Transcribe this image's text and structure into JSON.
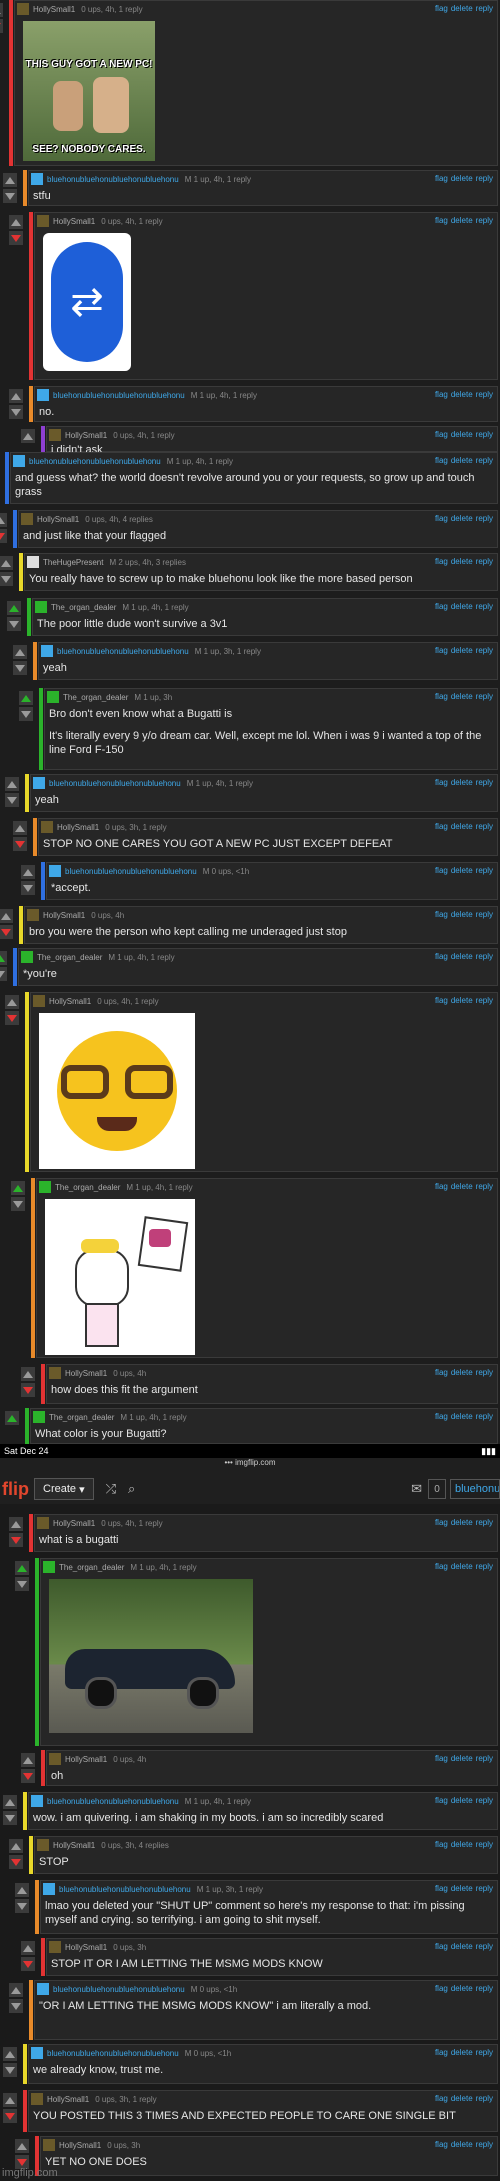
{
  "browser": {
    "date": "Sat Dec 24",
    "url": "imgflip.com",
    "logo": "flip",
    "create_label": "Create",
    "notif_count": "0",
    "search_value": "bluehonu"
  },
  "colors": {
    "bar_red": "#e23333",
    "bar_orange": "#e88a2a",
    "bar_yellow": "#e8d82a",
    "bar_green": "#2bb32b",
    "bar_blue": "#2f6fe0",
    "bar_purple": "#8e3fd1",
    "link_blue": "#3fa8e8"
  },
  "action_labels": {
    "flag": "flag",
    "delete": "delete",
    "reply": "reply"
  },
  "images": {
    "meme_top": "THIS GUY GOT A NEW PC!",
    "meme_bottom": "SEE? NOBODY CARES."
  },
  "comments": [
    {
      "user": "HollySmall1",
      "meta": "0 ups, 4h, 1 reply",
      "text": ""
    },
    {
      "user": "bluehonubluehonubluehonubluehonu",
      "meta": "M   1 up, 4h, 1 reply",
      "text": "stfu"
    },
    {
      "user": "HollySmall1",
      "meta": "0 ups, 4h, 1 reply",
      "text": ""
    },
    {
      "user": "bluehonubluehonubluehonubluehonu",
      "meta": "M   1 up, 4h, 1 reply",
      "text": "no."
    },
    {
      "user": "HollySmall1",
      "meta": "0 ups, 4h, 1 reply",
      "text": "i didn't ask"
    },
    {
      "user": "bluehonubluehonubluehonubluehonu",
      "meta": "M   1 up, 4h, 1 reply",
      "text": "and guess what? the world doesn't revolve around you or your requests, so grow up and touch grass"
    },
    {
      "user": "HollySmall1",
      "meta": "0 ups, 4h, 4 replies",
      "text": "and just like that your flagged"
    },
    {
      "user": "TheHugePresent",
      "meta": "M   2 ups, 4h, 3 replies",
      "text": "You really have to screw up to make bluehonu look like the more based person"
    },
    {
      "user": "The_organ_dealer",
      "meta": "M   1 up, 4h, 1 reply",
      "text": "The poor little dude won't survive a 3v1"
    },
    {
      "user": "bluehonubluehonubluehonubluehonu",
      "meta": "M   1 up, 3h, 1 reply",
      "text": "yeah"
    },
    {
      "user": "The_organ_dealer",
      "meta": "M   1 up, 3h",
      "text": "Bro don't even know what a Bugatti is"
    },
    {
      "user": "",
      "meta": "",
      "text": "It's literally every 9 y/o dream car. Well, except me lol. When i was 9 i wanted a top of the line Ford F-150"
    },
    {
      "user": "bluehonubluehonubluehonubluehonu",
      "meta": "M   1 up, 4h, 1 reply",
      "text": "yeah"
    },
    {
      "user": "HollySmall1",
      "meta": "0 ups, 3h, 1 reply",
      "text": "STOP NO ONE CARES YOU GOT A NEW PC JUST EXCEPT DEFEAT"
    },
    {
      "user": "bluehonubluehonubluehonubluehonu",
      "meta": "M   0 ups, <1h",
      "text": "*accept."
    },
    {
      "user": "HollySmall1",
      "meta": "0 ups, 4h",
      "text": "bro you were the person who kept calling me underaged just stop"
    },
    {
      "user": "The_organ_dealer",
      "meta": "M   1 up, 4h, 1 reply",
      "text": "*you're"
    },
    {
      "user": "HollySmall1",
      "meta": "0 ups, 4h, 1 reply",
      "text": ""
    },
    {
      "user": "The_organ_dealer",
      "meta": "M   1 up, 4h, 1 reply",
      "text": ""
    },
    {
      "user": "HollySmall1",
      "meta": "0 ups, 4h",
      "text": "how does this fit the argument"
    },
    {
      "user": "The_organ_dealer",
      "meta": "M   1 up, 4h, 1 reply",
      "text": "What color is your Bugatti?"
    },
    {
      "user": "HollySmall1",
      "meta": "0 ups, 4h, 1 reply",
      "text": "what is a bugatti"
    },
    {
      "user": "The_organ_dealer",
      "meta": "M   1 up, 4h, 1 reply",
      "text": ""
    },
    {
      "user": "HollySmall1",
      "meta": "0 ups, 4h",
      "text": "oh"
    },
    {
      "user": "bluehonubluehonubluehonubluehonu",
      "meta": "M   1 up, 4h, 1 reply",
      "text": "wow. i am quivering. i am shaking in my boots. i am so incredibly scared"
    },
    {
      "user": "HollySmall1",
      "meta": "0 ups, 3h, 4 replies",
      "text": "STOP"
    },
    {
      "user": "bluehonubluehonubluehonubluehonu",
      "meta": "M   1 up, 3h, 1 reply",
      "text": "lmao you deleted your \"SHUT UP\" comment so here's my response to that: i'm pissing myself and crying. so terrifying. i am going to shit myself."
    },
    {
      "user": "HollySmall1",
      "meta": "0 ups, 3h",
      "text": "STOP IT OR I AM LETTING THE MSMG MODS KNOW"
    },
    {
      "user": "bluehonubluehonubluehonubluehonu",
      "meta": "M   0 ups, <1h",
      "text": "\"OR I AM LETTING THE MSMG MODS KNOW\" i am literally a mod."
    },
    {
      "user": "bluehonubluehonubluehonubluehonu",
      "meta": "M   0 ups, <1h",
      "text": "we already know, trust me."
    },
    {
      "user": "HollySmall1",
      "meta": "0 ups, 3h, 1 reply",
      "text": "YOU POSTED THIS 3 TIMES AND EXPECTED PEOPLE TO CARE ONE SINGLE BIT"
    },
    {
      "user": "HollySmall1",
      "meta": "0 ups, 3h",
      "text": "YET NO ONE DOES"
    }
  ],
  "watermark": "imgflip.com"
}
